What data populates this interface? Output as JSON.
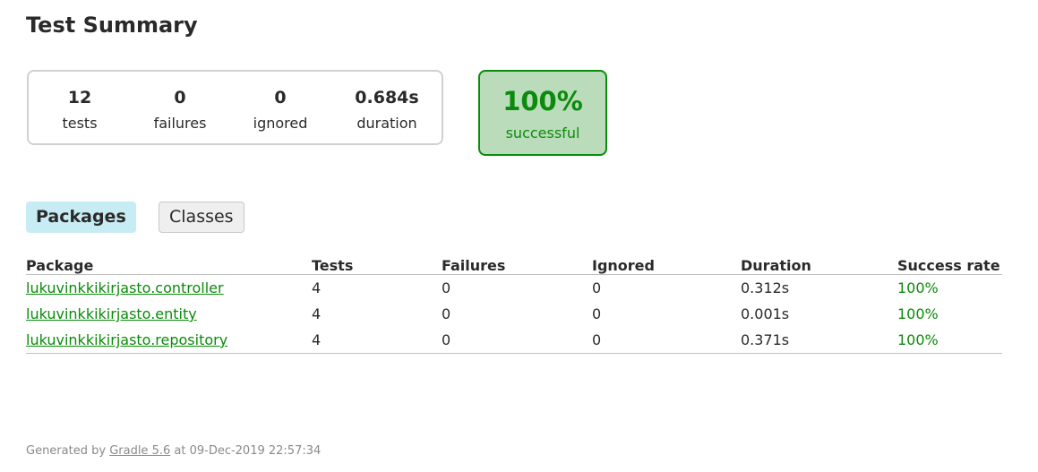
{
  "header": {
    "title": "Test Summary"
  },
  "summary": {
    "counters": [
      {
        "value": "12",
        "label": "tests"
      },
      {
        "value": "0",
        "label": "failures"
      },
      {
        "value": "0",
        "label": "ignored"
      },
      {
        "value": "0.684s",
        "label": "duration"
      }
    ],
    "success_rate": "100%",
    "success_label": "successful"
  },
  "tabs": [
    {
      "label": "Packages",
      "selected": true
    },
    {
      "label": "Classes",
      "selected": false
    }
  ],
  "packages_table": {
    "columns": [
      "Package",
      "Tests",
      "Failures",
      "Ignored",
      "Duration",
      "Success rate"
    ],
    "rows": [
      [
        "lukuvinkkikirjasto.controller",
        "4",
        "0",
        "0",
        "0.312s",
        "100%"
      ],
      [
        "lukuvinkkikirjasto.entity",
        "4",
        "0",
        "0",
        "0.001s",
        "100%"
      ],
      [
        "lukuvinkkikirjasto.repository",
        "4",
        "0",
        "0",
        "0.371s",
        "100%"
      ]
    ]
  },
  "footer": {
    "prefix": "Generated by",
    "link": "Gradle 5.6",
    "suffix": "at 09-Dec-2019 22:57:34"
  },
  "colors": {
    "success": "#0b8b0b",
    "success_background": "#bbdcbb",
    "selected_tab": "#c8ecf4"
  }
}
